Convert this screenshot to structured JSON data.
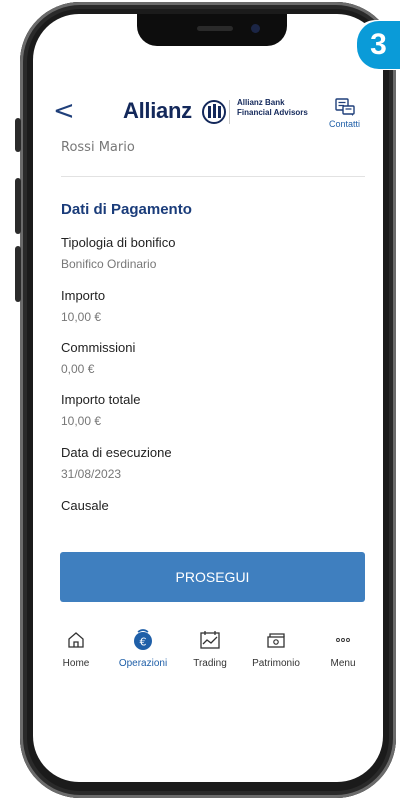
{
  "step_badge": "3",
  "header": {
    "back_glyph": "<",
    "logo_text": "Allianz",
    "brand_line1": "Allianz Bank",
    "brand_line2": "Financial Advisors",
    "contacts_label": "Contatti",
    "contacts_icon": "chat-icon"
  },
  "payee_name": "Rossi Mario",
  "section_title": "Dati di Pagamento",
  "fields": [
    {
      "label": "Tipologia di bonifico",
      "value": "Bonifico Ordinario"
    },
    {
      "label": "Importo",
      "value": "10,00 €"
    },
    {
      "label": "Commissioni",
      "value": "0,00 €"
    },
    {
      "label": "Importo totale",
      "value": "10,00 €"
    },
    {
      "label": "Data di esecuzione",
      "value": "31/08/2023"
    },
    {
      "label": "Causale",
      "value": ""
    }
  ],
  "cta_label": "PROSEGUI",
  "tabbar": {
    "active_color": "#1f5fa8",
    "items": [
      {
        "label": "Home",
        "icon": "home-icon"
      },
      {
        "label": "Operazioni",
        "icon": "euro-icon",
        "active": true
      },
      {
        "label": "Trading",
        "icon": "chart-icon"
      },
      {
        "label": "Patrimonio",
        "icon": "wallet-icon"
      },
      {
        "label": "Menu",
        "icon": "more-icon"
      }
    ]
  },
  "colors": {
    "brand_navy": "#13285a",
    "cta_blue": "#3f7fbf",
    "step_badge": "#0a9bd8"
  }
}
